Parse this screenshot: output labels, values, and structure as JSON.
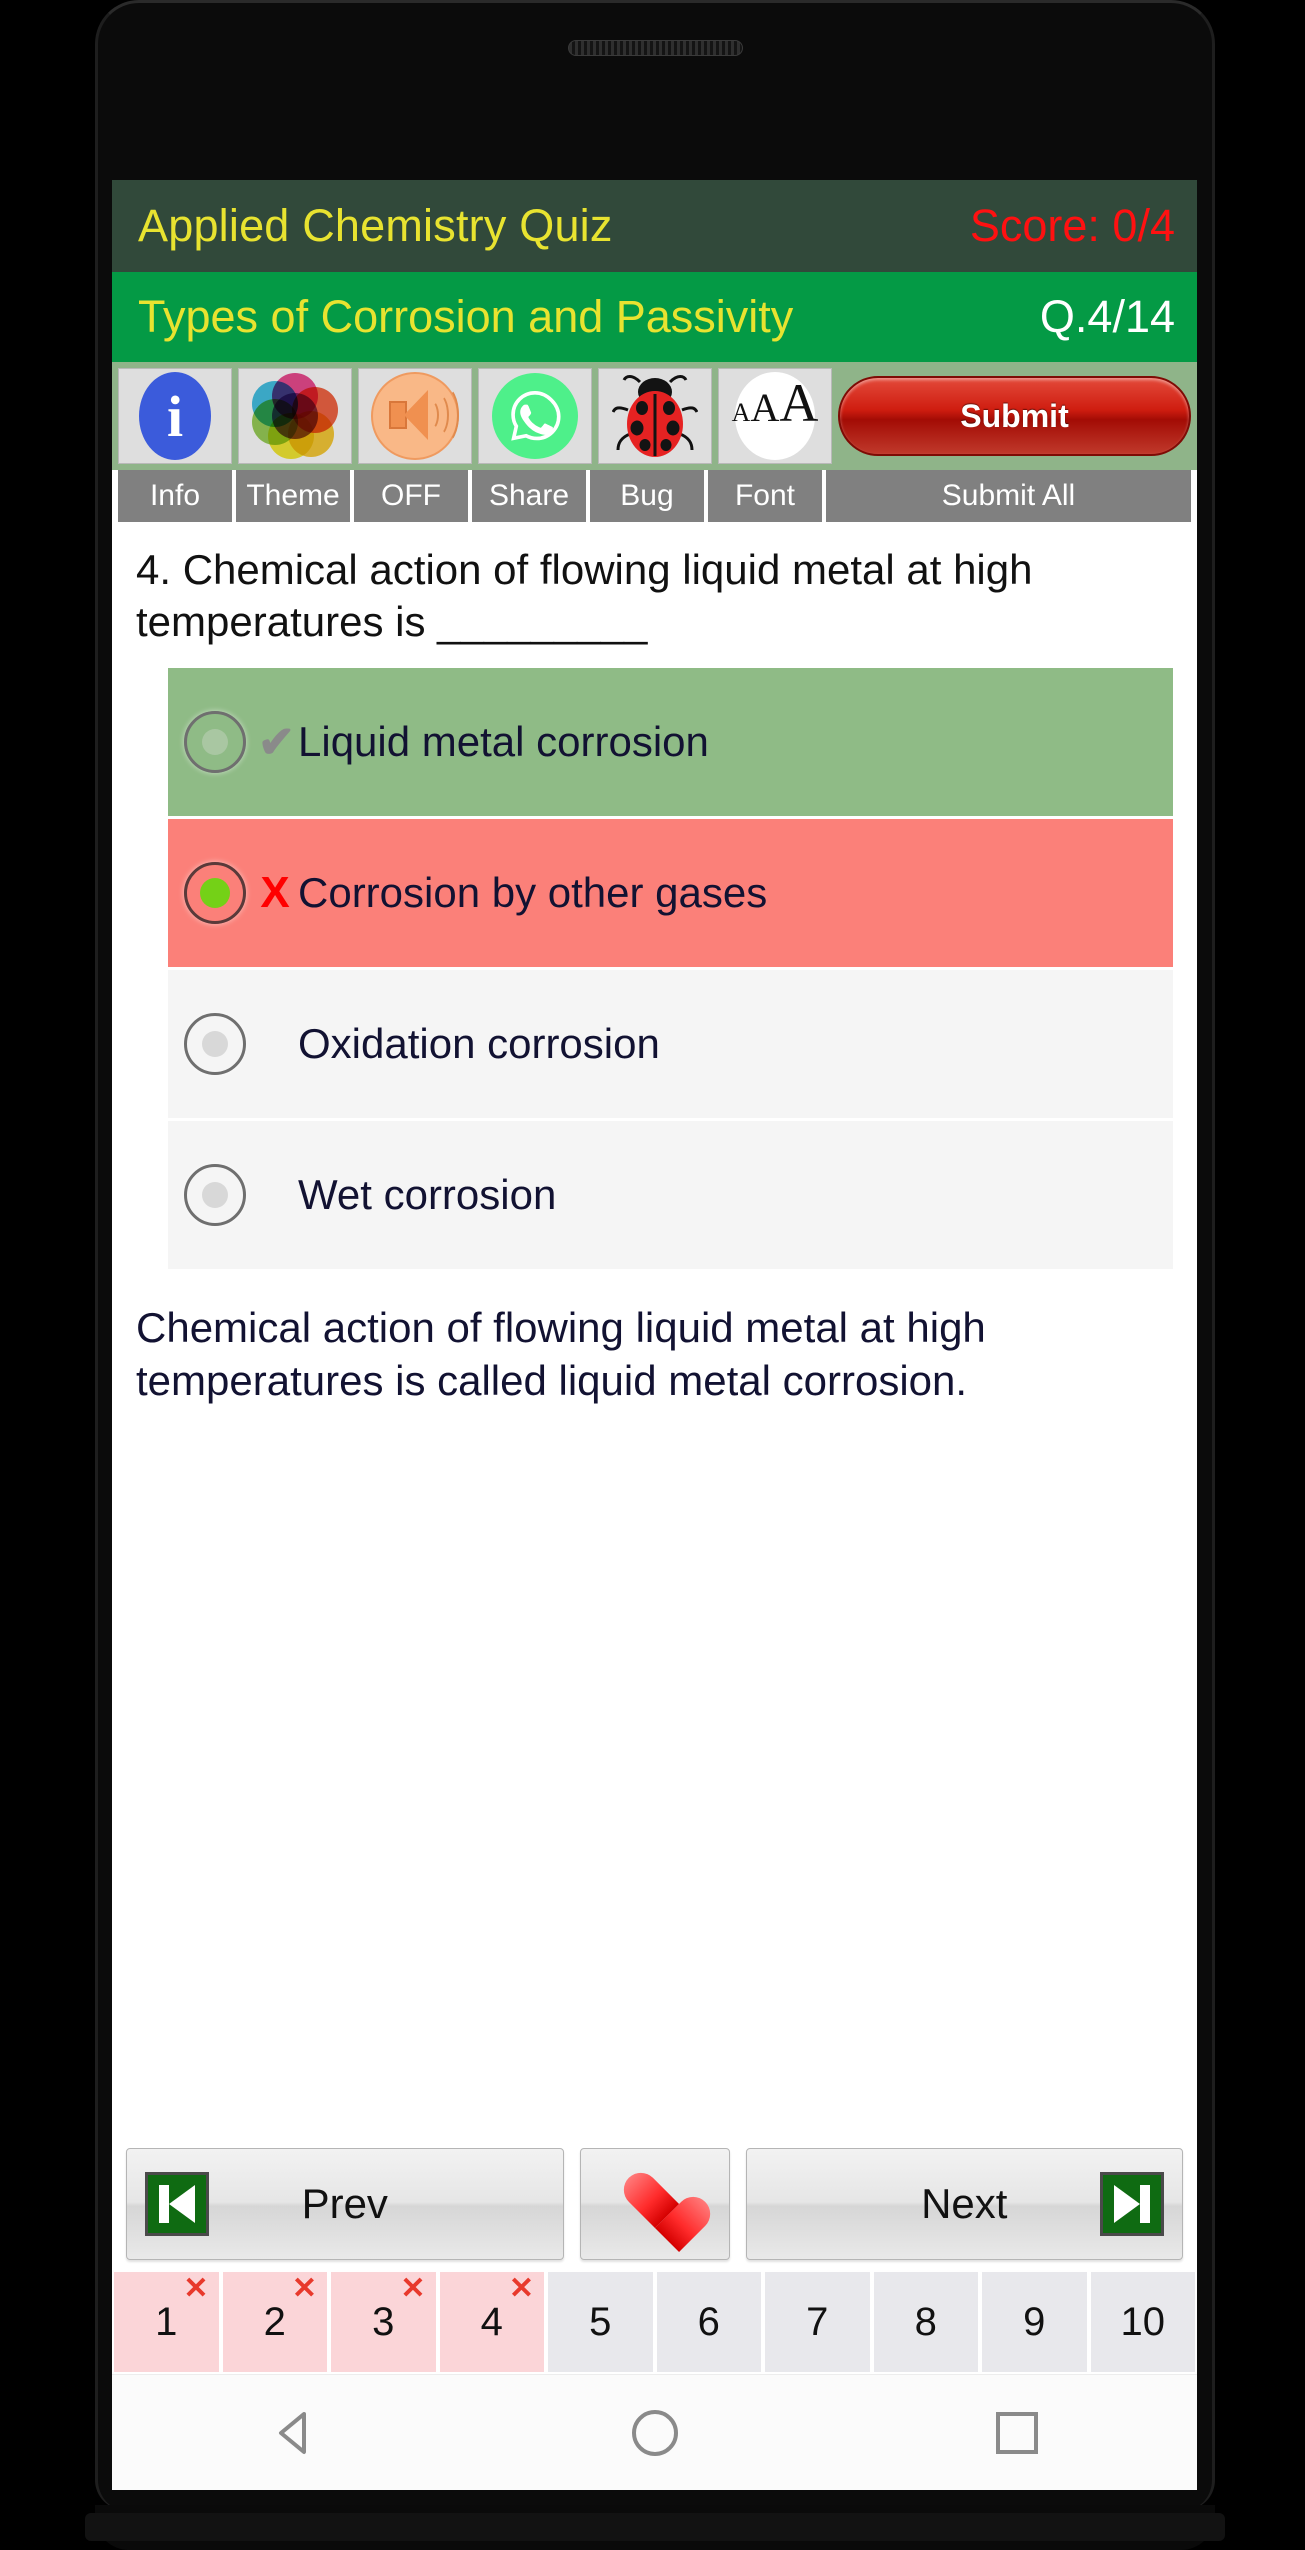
{
  "header": {
    "app_title": "Applied Chemistry Quiz",
    "score_label": "Score: 0/4",
    "subtitle": "Types of Corrosion and Passivity",
    "question_counter": "Q.4/14",
    "title_bg": "#31493a",
    "subtitle_bg": "#049a45",
    "title_text_color": "#e8e330",
    "score_color": "#ff1111"
  },
  "toolbar": {
    "items": [
      {
        "icon": "info-icon",
        "label": "Info"
      },
      {
        "icon": "palette-icon",
        "label": "Theme"
      },
      {
        "icon": "speaker-icon",
        "label": "OFF"
      },
      {
        "icon": "whatsapp-icon",
        "label": "Share"
      },
      {
        "icon": "ladybug-icon",
        "label": "Bug"
      },
      {
        "icon": "font-size-icon",
        "label": "Font"
      }
    ],
    "submit_label": "Submit",
    "submit_all_label": "Submit All",
    "font_icon_text": {
      "small": "A",
      "medium": "A",
      "large": "A"
    }
  },
  "question": {
    "text": "4. Chemical action of flowing liquid metal at high temperatures is _________"
  },
  "options": [
    {
      "text": "Liquid metal corrosion",
      "state": "correct",
      "mark": "✔",
      "selected": false
    },
    {
      "text": "Corrosion by other gases",
      "state": "wrong",
      "mark": "X",
      "selected": true
    },
    {
      "text": "Oxidation corrosion",
      "state": "neutral",
      "mark": "",
      "selected": false
    },
    {
      "text": "Wet corrosion",
      "state": "neutral",
      "mark": "",
      "selected": false
    }
  ],
  "explanation": {
    "text": "Chemical action of flowing liquid metal at high temperatures is called liquid metal corrosion."
  },
  "nav": {
    "prev_label": "Prev",
    "next_label": "Next",
    "favorite_icon": "heart-icon"
  },
  "pagination": {
    "pages": [
      {
        "number": "1",
        "answered": true,
        "badge": "✕"
      },
      {
        "number": "2",
        "answered": true,
        "badge": "✕"
      },
      {
        "number": "3",
        "answered": true,
        "badge": "✕"
      },
      {
        "number": "4",
        "answered": true,
        "badge": "✕"
      },
      {
        "number": "5",
        "answered": false,
        "badge": ""
      },
      {
        "number": "6",
        "answered": false,
        "badge": ""
      },
      {
        "number": "7",
        "answered": false,
        "badge": ""
      },
      {
        "number": "8",
        "answered": false,
        "badge": ""
      },
      {
        "number": "9",
        "answered": false,
        "badge": ""
      },
      {
        "number": "10",
        "answered": false,
        "badge": ""
      }
    ]
  },
  "system_nav": {
    "back": "back-triangle-icon",
    "home": "home-circle-icon",
    "recents": "recents-square-icon"
  }
}
